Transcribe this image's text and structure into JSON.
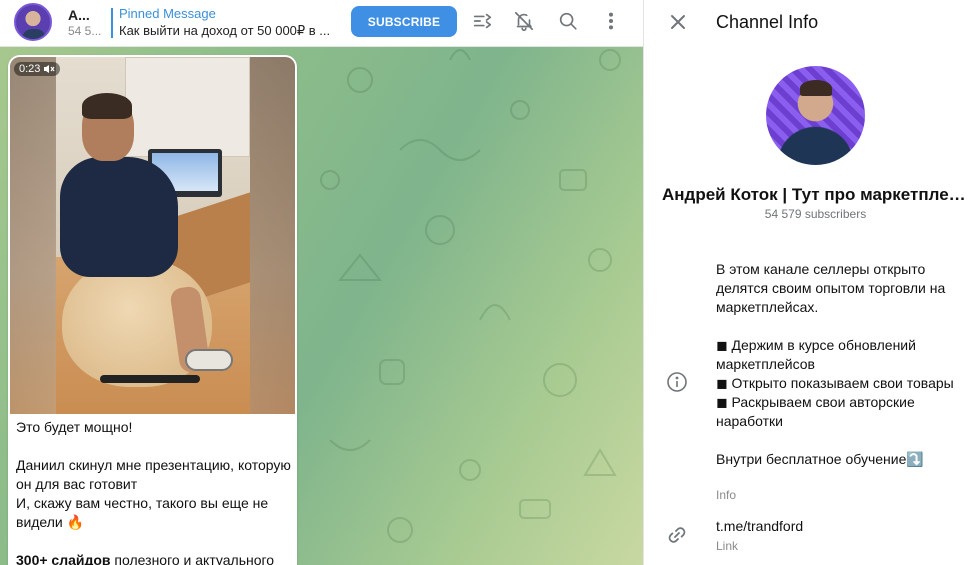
{
  "header": {
    "title": "А...",
    "subtitle": "54 5...",
    "pinned_title": "Pinned Message",
    "pinned_text": "Как выйти на доход от 50 000₽ в ...",
    "subscribe_label": "SUBSCRIBE"
  },
  "message": {
    "duration": "0:23",
    "lines": [
      "Это будет мощно!",
      "Даниил скинул мне презентацию, которую он для вас готовит\nИ, скажу вам честно, такого вы еще не видели 🔥",
      "300+ слайдов полезного и актуального"
    ],
    "bold_start": "300+ слайдов",
    "rest": " полезного и актуального"
  },
  "panel": {
    "title": "Channel Info",
    "channel_name": "Андрей Коток | Тут про маркетплейсы",
    "subscribers": "54 579 subscribers",
    "description": "В этом канале селлеры открыто делятся своим опытом торговли на маркетплейсах.\n\n ◼ Держим в курсе обновлений маркетплейсов\n ◼ Открыто показываем свои товары\n ◼ Раскрываем свои авторские наработки\n\nВнутри бесплатное обучение⤵️",
    "description_label": "Info",
    "link": "t.me/trandford",
    "link_label": "Link"
  },
  "colors": {
    "accent": "#3f90e4",
    "pinned": "#3a8fd8",
    "secondary_text": "#707579"
  },
  "icons": [
    "voice-chat-icon",
    "mute-icon",
    "search-icon",
    "more-icon",
    "close-icon",
    "info-icon",
    "link-icon",
    "volume-mute-icon"
  ]
}
